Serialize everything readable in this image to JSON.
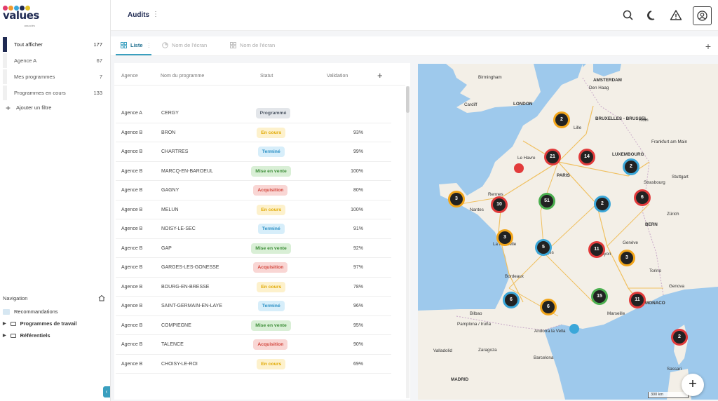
{
  "logo": {
    "text": "values",
    "sub": "associés",
    "dot_colors": [
      "#e23b6a",
      "#f29a2e",
      "#3ba7d9",
      "#1f2a52",
      "#e4c227"
    ]
  },
  "sidebar": {
    "filters": [
      {
        "label": "Tout afficher",
        "count": "177"
      },
      {
        "label": "Agence A",
        "count": "67"
      },
      {
        "label": "Mes programmes",
        "count": "7"
      },
      {
        "label": "Programmes en cours",
        "count": "133"
      }
    ],
    "add_filter": "Ajouter un filtre",
    "navigation": {
      "title": "Navigation",
      "items": [
        "Recommandations",
        "Programmes de travail",
        "Référentiels"
      ]
    }
  },
  "header": {
    "title": "Audits"
  },
  "tabs": [
    "Liste",
    "Nom de l'écran",
    "Nom de l'écran"
  ],
  "table": {
    "columns": [
      "Agence",
      "Nom du programme",
      "Statut",
      "Validation"
    ],
    "rows": [
      {
        "agence": "Agence A",
        "programme": "CERGY",
        "statut": "Programmé",
        "validation": ""
      },
      {
        "agence": "Agence B",
        "programme": "BRON",
        "statut": "En cours",
        "validation": "93%"
      },
      {
        "agence": "Agence B",
        "programme": "CHARTRES",
        "statut": "Terminé",
        "validation": "99%"
      },
      {
        "agence": "Agence B",
        "programme": "MARCQ-EN-BAROEUL",
        "statut": "Mise en vente",
        "validation": "100%"
      },
      {
        "agence": "Agence B",
        "programme": "GAGNY",
        "statut": "Acquisition",
        "validation": "80%"
      },
      {
        "agence": "Agence B",
        "programme": "MELUN",
        "statut": "En cours",
        "validation": "100%"
      },
      {
        "agence": "Agence B",
        "programme": "NOISY-LE-SEC",
        "statut": "Terminé",
        "validation": "91%"
      },
      {
        "agence": "Agence B",
        "programme": "GAP",
        "statut": "Mise en vente",
        "validation": "92%"
      },
      {
        "agence": "Agence B",
        "programme": "GARGES-LES-GONESSE",
        "statut": "Acquisition",
        "validation": "97%"
      },
      {
        "agence": "Agence B",
        "programme": "BOURG-EN-BRESSE",
        "statut": "En cours",
        "validation": "78%"
      },
      {
        "agence": "Agence B",
        "programme": "SAINT-GERMAIN-EN-LAYE",
        "statut": "Terminé",
        "validation": "96%"
      },
      {
        "agence": "Agence B",
        "programme": "COMPIEGNE",
        "statut": "Mise en vente",
        "validation": "95%"
      },
      {
        "agence": "Agence B",
        "programme": "TALENCE",
        "statut": "Acquisition",
        "validation": "90%"
      },
      {
        "agence": "Agence B",
        "programme": "CHOISY-LE-ROI",
        "statut": "En cours",
        "validation": "69%"
      }
    ]
  },
  "status_colors": {
    "Programmé": {
      "bg": "#e3e6ea",
      "fg": "#555e6b"
    },
    "En cours": {
      "bg": "#fdf1cc",
      "fg": "#e0a800"
    },
    "Terminé": {
      "bg": "#d7eefa",
      "fg": "#2a8fc4"
    },
    "Mise en vente": {
      "bg": "#d9efd6",
      "fg": "#3f8f3a"
    },
    "Acquisition": {
      "bg": "#f9d6d4",
      "fg": "#d2433a"
    }
  },
  "map": {
    "labels": [
      "Birmingham",
      "AMSTERDAM",
      "Den Haag",
      "Cardiff",
      "LONDON",
      "BRUXELLES - BRUSSEL",
      "Lille",
      "Köln",
      "Frankfurt am Main",
      "LUXEMBOURG",
      "Le Havre",
      "Stuttgart",
      "Strasbourg",
      "Rennes",
      "PARIS",
      "Zürich",
      "BERN",
      "Nantes",
      "La Rochelle",
      "Limoges",
      "Lyon",
      "Genève",
      "Torino",
      "Genova",
      "Bordeaux",
      "MONACO",
      "Marseille",
      "Bilbao",
      "Pamplona / Iruña",
      "Andorra la Vella",
      "Valladolid",
      "Zaragoza",
      "Barcelona",
      "MADRID",
      "Sassari"
    ],
    "clusters": [
      {
        "count": "2",
        "ring": "#f2a51a"
      },
      {
        "count": "21",
        "ring": "#e23b3b"
      },
      {
        "count": "14",
        "ring": "#e23b3b"
      },
      {
        "count": "2",
        "ring": "#3ba7d9"
      },
      {
        "count": "3",
        "ring": "#f2a51a"
      },
      {
        "count": "10",
        "ring": "#e23b3b"
      },
      {
        "count": "51",
        "ring": "#4caf50"
      },
      {
        "count": "2",
        "ring": "#3ba7d9"
      },
      {
        "count": "6",
        "ring": "#e23b3b"
      },
      {
        "count": "3",
        "ring": "#f2a51a"
      },
      {
        "count": "5",
        "ring": "#3ba7d9"
      },
      {
        "count": "11",
        "ring": "#e23b3b"
      },
      {
        "count": "3",
        "ring": "#f2a51a"
      },
      {
        "count": "6",
        "ring": "#3ba7d9"
      },
      {
        "count": "6",
        "ring": "#f2a51a"
      },
      {
        "count": "15",
        "ring": "#4caf50"
      },
      {
        "count": "11",
        "ring": "#e23b3b"
      },
      {
        "count": "2",
        "ring": "#e23b3b"
      }
    ],
    "pin_colors": [
      "#e23b3b",
      "#3ba7d9"
    ],
    "scale": "300 km"
  }
}
